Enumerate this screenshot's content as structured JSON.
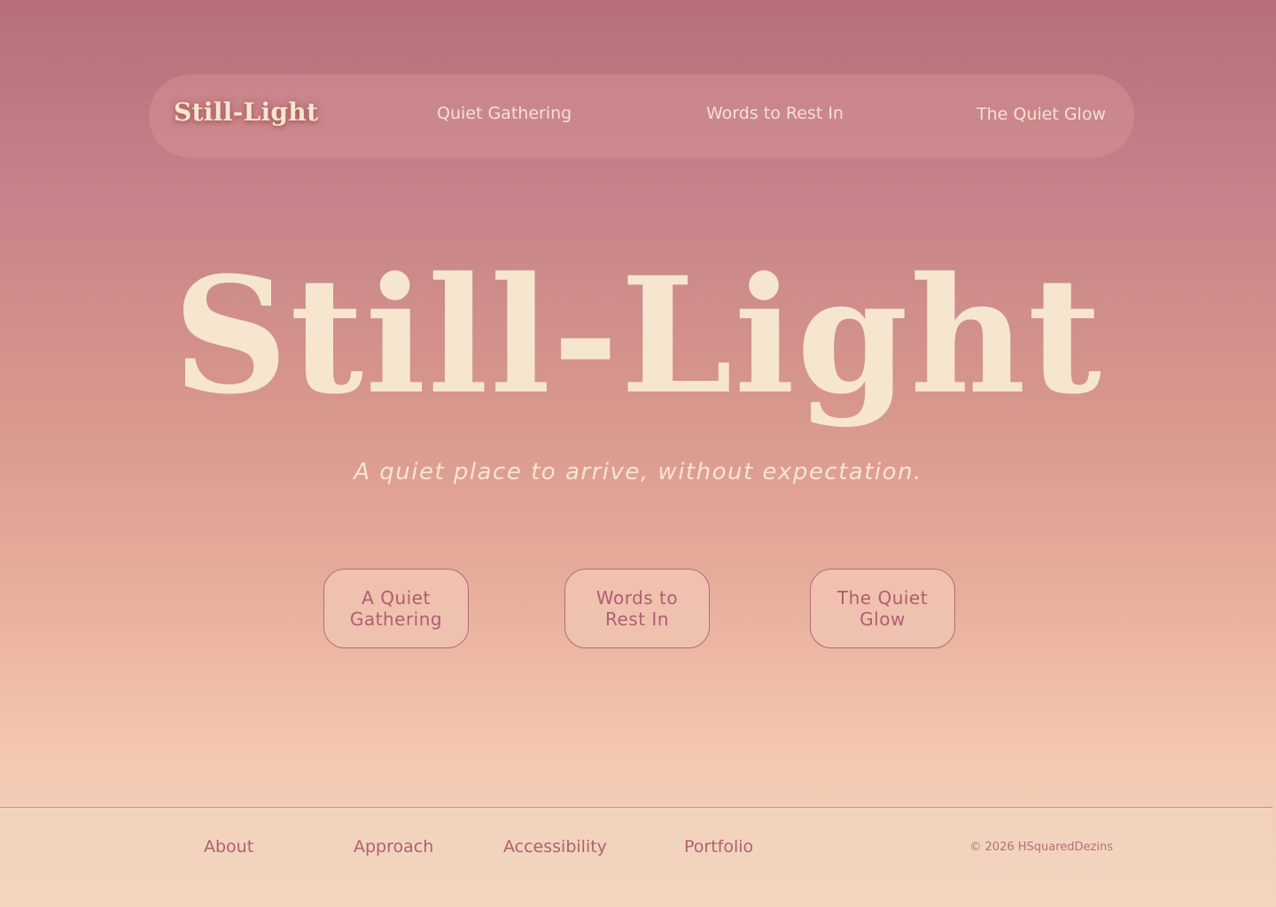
{
  "nav": {
    "logo": "Still-Light",
    "links": [
      {
        "label": "Quiet Gathering"
      },
      {
        "label": "Words to Rest In"
      },
      {
        "label": "The Quiet Glow"
      }
    ]
  },
  "hero": {
    "title": "Still-Light",
    "subtitle": "A quiet place to arrive, without expectation."
  },
  "cta_buttons": [
    {
      "label": "A Quiet Gathering"
    },
    {
      "label": "Words to Rest In"
    },
    {
      "label": "The Quiet Glow"
    }
  ],
  "footer": {
    "links": [
      {
        "label": "About"
      },
      {
        "label": "Approach"
      },
      {
        "label": "Accessibility"
      },
      {
        "label": "Portfolio"
      }
    ],
    "copyright": "© 2026 HSquaredDezins"
  },
  "colors": {
    "gradient_top": "#b76e7a",
    "gradient_bottom": "#f1d6c0",
    "cream_text": "#f7e6cf",
    "rose_text": "#b05e72",
    "button_border": "#b46a7a"
  }
}
